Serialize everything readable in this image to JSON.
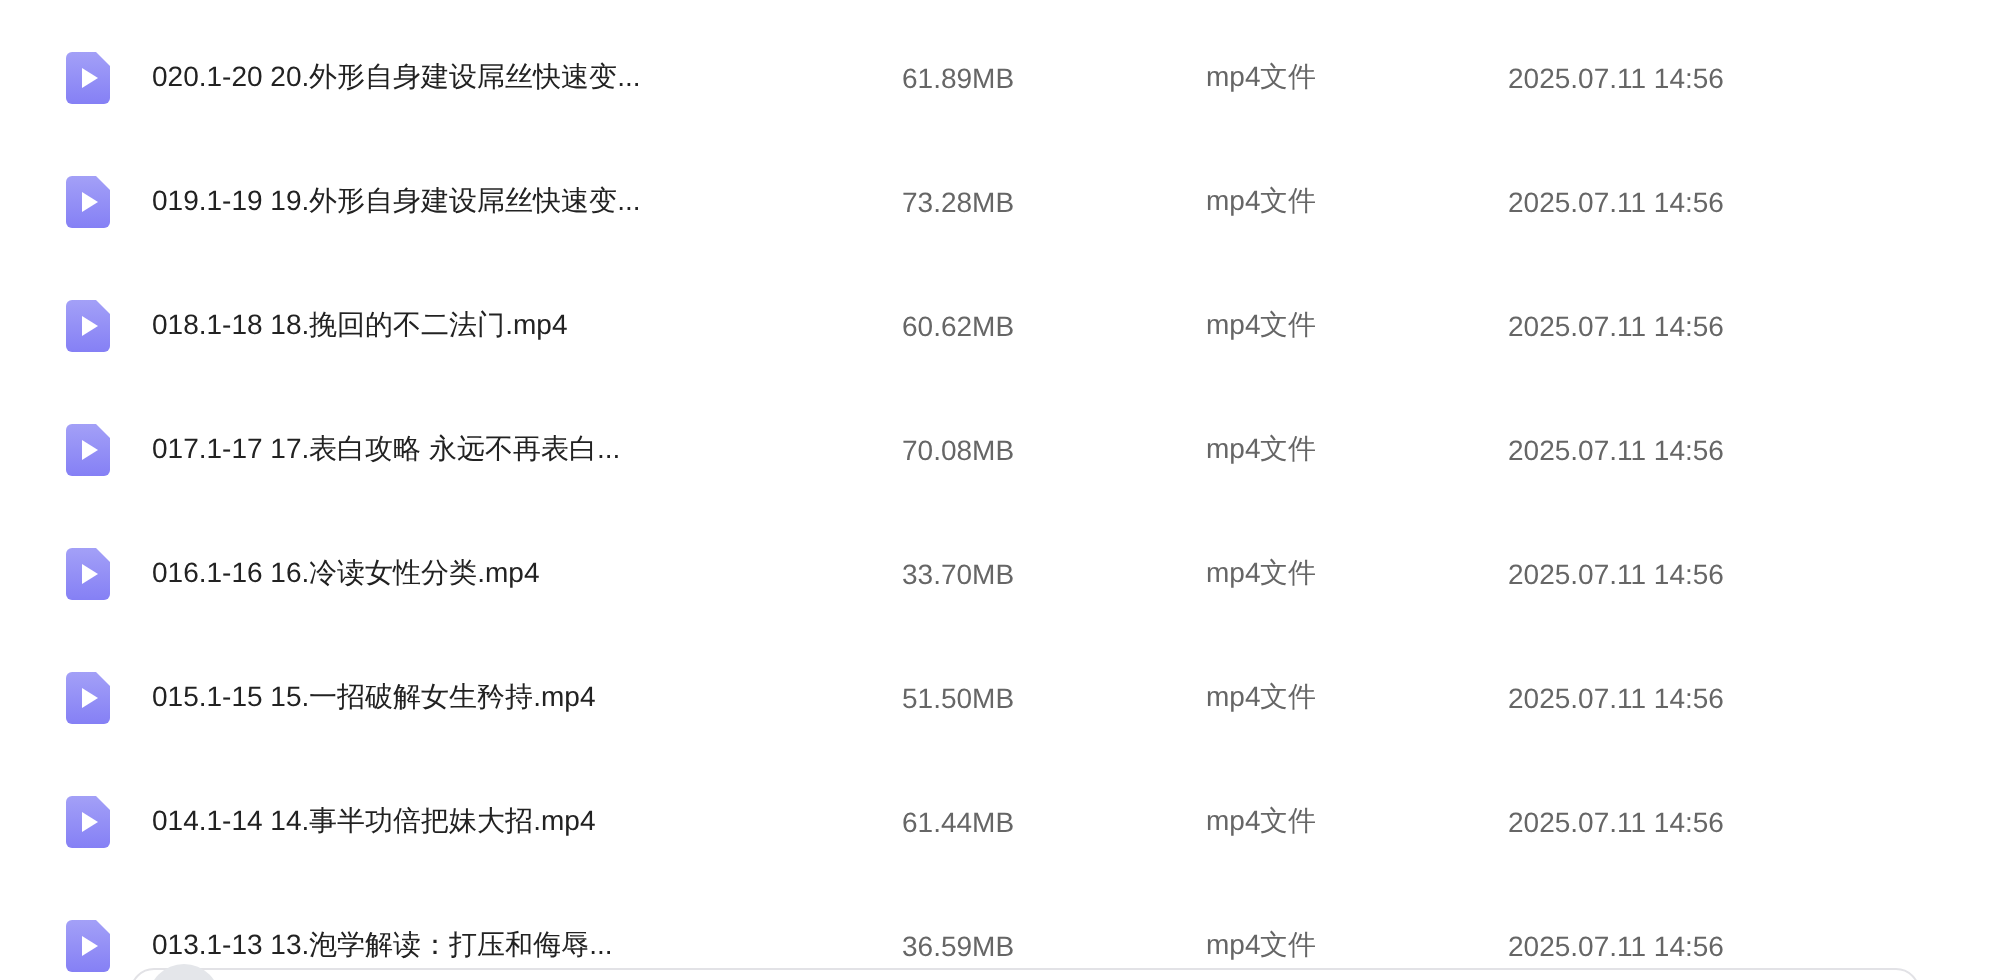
{
  "files": [
    {
      "name": "020.1-20 20.外形自身建设屌丝快速变...",
      "size": "61.89MB",
      "type": "mp4文件",
      "modified": "2025.07.11 14:56"
    },
    {
      "name": "019.1-19 19.外形自身建设屌丝快速变...",
      "size": "73.28MB",
      "type": "mp4文件",
      "modified": "2025.07.11 14:56"
    },
    {
      "name": "018.1-18 18.挽回的不二法门.mp4",
      "size": "60.62MB",
      "type": "mp4文件",
      "modified": "2025.07.11 14:56"
    },
    {
      "name": "017.1-17 17.表白攻略 永远不再表白...",
      "size": "70.08MB",
      "type": "mp4文件",
      "modified": "2025.07.11 14:56"
    },
    {
      "name": "016.1-16 16.冷读女性分类.mp4",
      "size": "33.70MB",
      "type": "mp4文件",
      "modified": "2025.07.11 14:56"
    },
    {
      "name": "015.1-15 15.一招破解女生矜持.mp4",
      "size": "51.50MB",
      "type": "mp4文件",
      "modified": "2025.07.11 14:56"
    },
    {
      "name": "014.1-14 14.事半功倍把妹大招.mp4",
      "size": "61.44MB",
      "type": "mp4文件",
      "modified": "2025.07.11 14:56"
    },
    {
      "name": "013.1-13 13.泡学解读：打压和侮辱...",
      "size": "36.59MB",
      "type": "mp4文件",
      "modified": "2025.07.11 14:56"
    }
  ]
}
